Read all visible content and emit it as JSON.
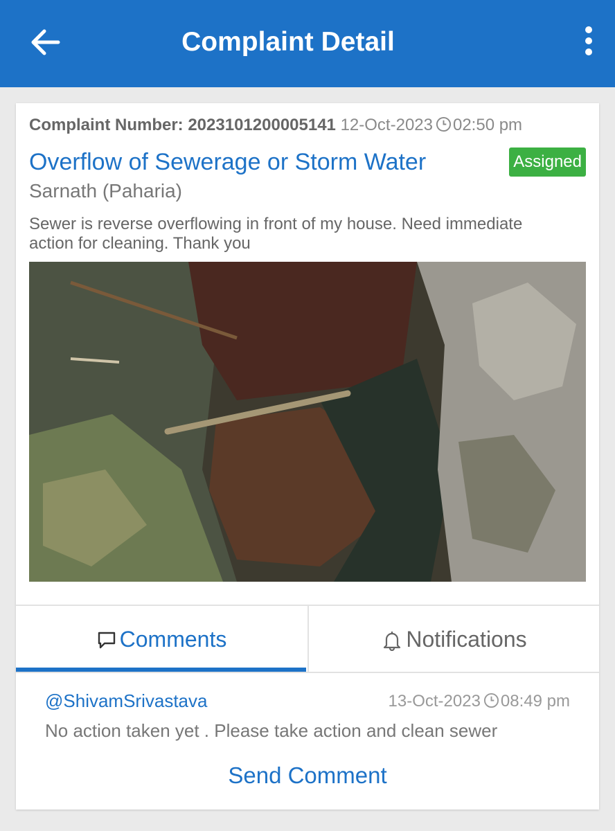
{
  "header": {
    "title": "Complaint Detail",
    "back_icon": "arrow-left-icon",
    "menu_icon": "more-vertical-icon"
  },
  "complaint": {
    "number_label": "Complaint Number: 2023101200005141",
    "date": "12-Oct-2023",
    "time": "02:50 pm",
    "title": "Overflow of Sewerage or Storm Water",
    "status": "Assigned",
    "location": "Sarnath (Paharia)",
    "description": "Sewer is reverse overflowing in front of my house. Need immediate action for cleaning. Thank you",
    "photo_alt": "Photo of overflowing sewer drain"
  },
  "tabs": [
    {
      "label": "Comments",
      "icon": "comment-icon",
      "active": true
    },
    {
      "label": "Notifications",
      "icon": "bell-icon",
      "active": false
    }
  ],
  "comments": [
    {
      "user": "@ShivamSrivastava",
      "date": "13-Oct-2023",
      "time": "08:49 pm",
      "text": "No action taken yet . Please take action and clean sewer"
    }
  ],
  "send_label": "Send Comment",
  "colors": {
    "primary": "#1d72c7",
    "status_assigned": "#3cb043",
    "background": "#eaeaea"
  }
}
